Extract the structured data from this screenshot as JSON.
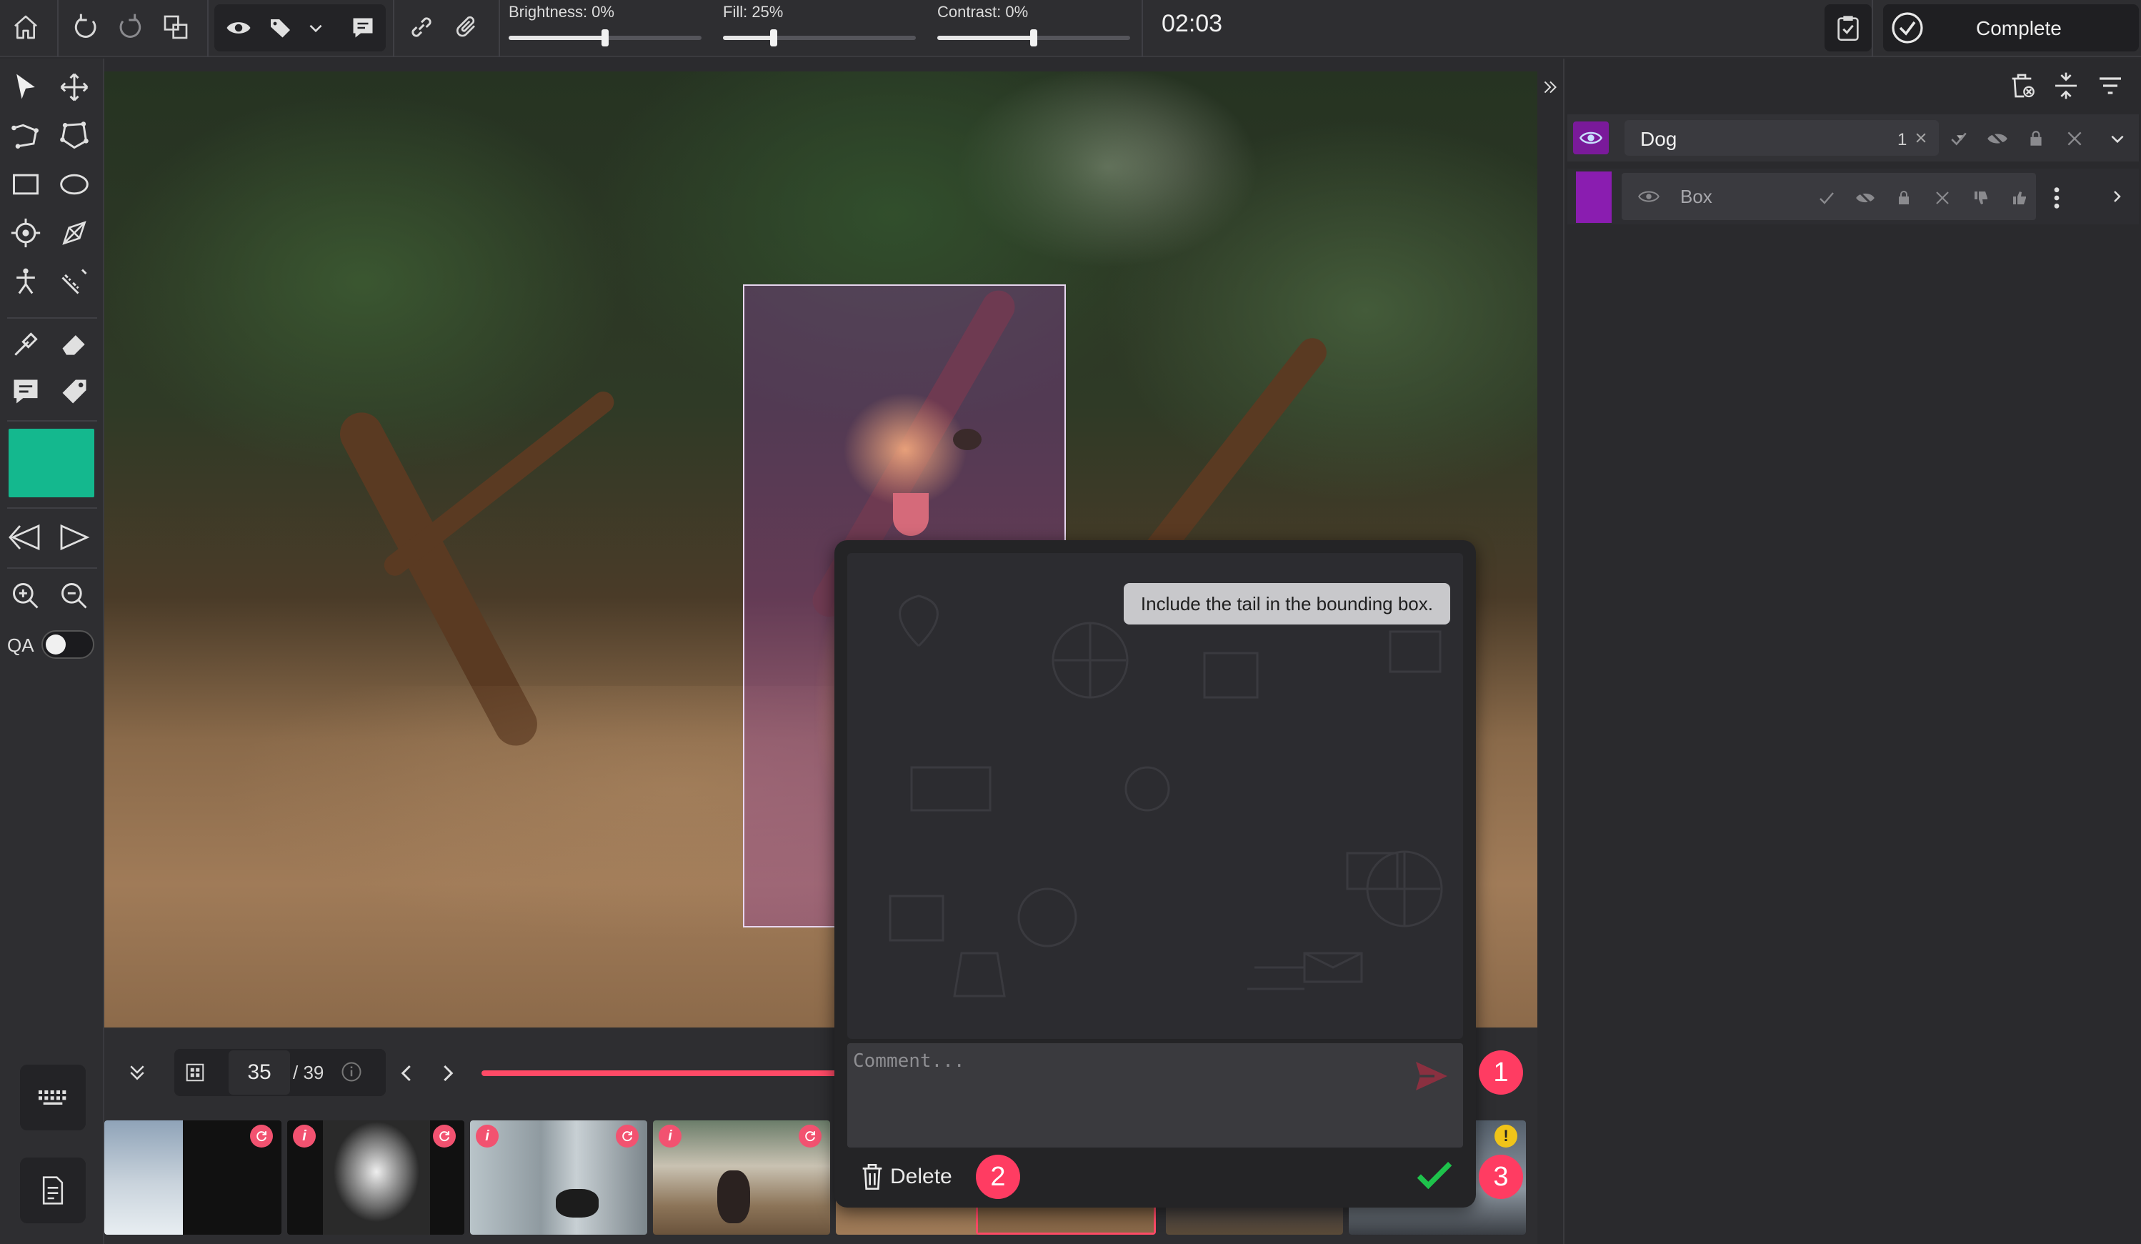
{
  "colors": {
    "accent_teal": "#14b88e",
    "class_purple": "#8a1db0",
    "alert_pink": "#ff3c62",
    "progress_red": "#ff4a66",
    "confirm_green": "#1ec24b",
    "warning_yellow": "#f0c419"
  },
  "toolbar": {
    "home_icon": "home-icon",
    "undo_icon": "undo-icon",
    "redo_icon": "redo-icon",
    "brightness_label": "Brightness: 0%",
    "brightness_value": 0,
    "fill_label": "Fill: 25%",
    "fill_value": 25,
    "contrast_label": "Contrast: 0%",
    "contrast_value": 0,
    "timer": "02:03",
    "complete_label": "Complete"
  },
  "left_tools": {
    "qa_label": "QA",
    "qa_enabled": false,
    "active_color": "#14b88e"
  },
  "right_panel": {
    "class": {
      "name": "Dog",
      "count": "1"
    },
    "object": {
      "name": "Box",
      "color": "#8a1db0"
    }
  },
  "navigation": {
    "current_page": "35",
    "total_pages": "/ 39"
  },
  "thumbnails": [
    {
      "subject": "white husky in snow",
      "status": "refresh"
    },
    {
      "subject": "husky portrait",
      "status": "refresh"
    },
    {
      "subject": "black puppy by window",
      "status": "refresh"
    },
    {
      "subject": "black dog in living room",
      "status": "refresh"
    },
    {
      "subject": "dog on ground",
      "status": "info"
    },
    {
      "subject": "current image",
      "status": "selected"
    },
    {
      "subject": "street scene",
      "status": "none"
    },
    {
      "subject": "street scene 2",
      "status": "warning"
    }
  ],
  "comment_popup": {
    "message": "Include the tail in the bounding box.",
    "placeholder": "Comment...",
    "delete_label": "Delete",
    "badge_1": "1",
    "badge_2": "2",
    "badge_3": "3"
  }
}
